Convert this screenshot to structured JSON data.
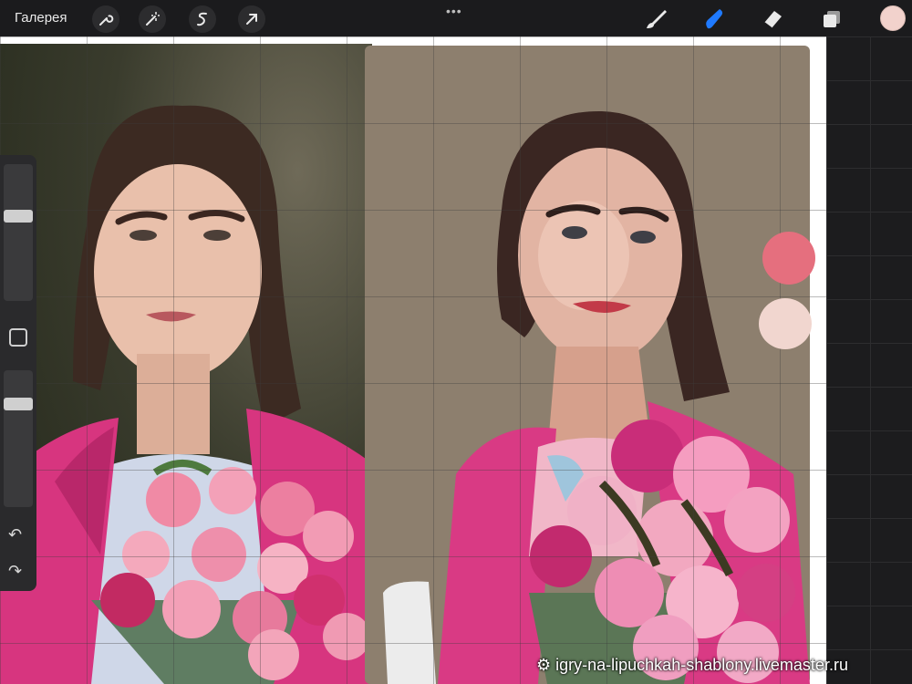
{
  "topbar": {
    "gallery_label": "Галерея",
    "tools_left": [
      "wrench-icon",
      "magic-wand-icon",
      "selection-icon",
      "transform-arrow-icon"
    ],
    "tools_right": [
      "brush-icon",
      "smudge-icon",
      "eraser-icon",
      "layers-icon"
    ],
    "active_tool": "smudge-icon",
    "current_color": "#f2d2cc"
  },
  "sidebar": {
    "brush_size_level": 0.63,
    "opacity_level": 0.78,
    "undo_icon": "undo-icon",
    "redo_icon": "redo-icon"
  },
  "canvas": {
    "color_swatches": [
      "#e56f7e",
      "#f1d6cf"
    ],
    "left_panel": "reference-photo",
    "right_panel": "painting-in-progress"
  },
  "watermark": {
    "text": "igry-na-lipuchkah-shablony.livemaster.ru"
  },
  "colors": {
    "accent": "#1f7aff",
    "toolbar_bg": "#1b1b1d",
    "coat_pink": "#d7357f"
  }
}
